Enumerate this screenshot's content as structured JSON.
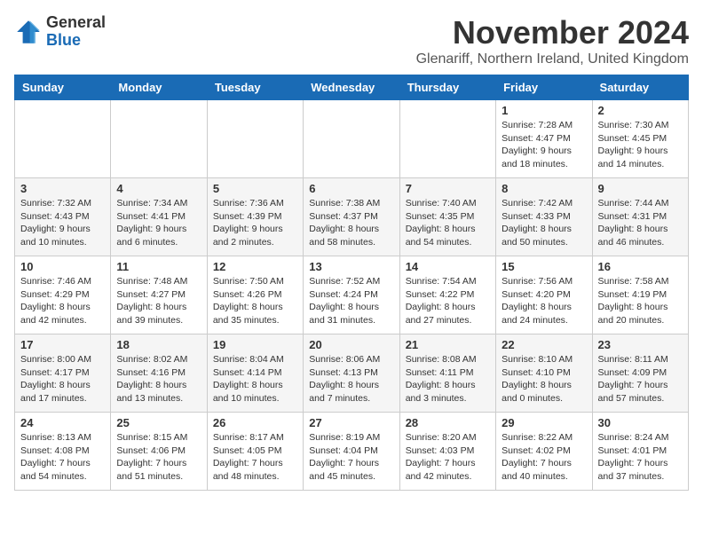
{
  "logo": {
    "general": "General",
    "blue": "Blue"
  },
  "title": "November 2024",
  "location": "Glenariff, Northern Ireland, United Kingdom",
  "days_of_week": [
    "Sunday",
    "Monday",
    "Tuesday",
    "Wednesday",
    "Thursday",
    "Friday",
    "Saturday"
  ],
  "weeks": [
    [
      {
        "day": "",
        "detail": ""
      },
      {
        "day": "",
        "detail": ""
      },
      {
        "day": "",
        "detail": ""
      },
      {
        "day": "",
        "detail": ""
      },
      {
        "day": "",
        "detail": ""
      },
      {
        "day": "1",
        "detail": "Sunrise: 7:28 AM\nSunset: 4:47 PM\nDaylight: 9 hours and 18 minutes."
      },
      {
        "day": "2",
        "detail": "Sunrise: 7:30 AM\nSunset: 4:45 PM\nDaylight: 9 hours and 14 minutes."
      }
    ],
    [
      {
        "day": "3",
        "detail": "Sunrise: 7:32 AM\nSunset: 4:43 PM\nDaylight: 9 hours and 10 minutes."
      },
      {
        "day": "4",
        "detail": "Sunrise: 7:34 AM\nSunset: 4:41 PM\nDaylight: 9 hours and 6 minutes."
      },
      {
        "day": "5",
        "detail": "Sunrise: 7:36 AM\nSunset: 4:39 PM\nDaylight: 9 hours and 2 minutes."
      },
      {
        "day": "6",
        "detail": "Sunrise: 7:38 AM\nSunset: 4:37 PM\nDaylight: 8 hours and 58 minutes."
      },
      {
        "day": "7",
        "detail": "Sunrise: 7:40 AM\nSunset: 4:35 PM\nDaylight: 8 hours and 54 minutes."
      },
      {
        "day": "8",
        "detail": "Sunrise: 7:42 AM\nSunset: 4:33 PM\nDaylight: 8 hours and 50 minutes."
      },
      {
        "day": "9",
        "detail": "Sunrise: 7:44 AM\nSunset: 4:31 PM\nDaylight: 8 hours and 46 minutes."
      }
    ],
    [
      {
        "day": "10",
        "detail": "Sunrise: 7:46 AM\nSunset: 4:29 PM\nDaylight: 8 hours and 42 minutes."
      },
      {
        "day": "11",
        "detail": "Sunrise: 7:48 AM\nSunset: 4:27 PM\nDaylight: 8 hours and 39 minutes."
      },
      {
        "day": "12",
        "detail": "Sunrise: 7:50 AM\nSunset: 4:26 PM\nDaylight: 8 hours and 35 minutes."
      },
      {
        "day": "13",
        "detail": "Sunrise: 7:52 AM\nSunset: 4:24 PM\nDaylight: 8 hours and 31 minutes."
      },
      {
        "day": "14",
        "detail": "Sunrise: 7:54 AM\nSunset: 4:22 PM\nDaylight: 8 hours and 27 minutes."
      },
      {
        "day": "15",
        "detail": "Sunrise: 7:56 AM\nSunset: 4:20 PM\nDaylight: 8 hours and 24 minutes."
      },
      {
        "day": "16",
        "detail": "Sunrise: 7:58 AM\nSunset: 4:19 PM\nDaylight: 8 hours and 20 minutes."
      }
    ],
    [
      {
        "day": "17",
        "detail": "Sunrise: 8:00 AM\nSunset: 4:17 PM\nDaylight: 8 hours and 17 minutes."
      },
      {
        "day": "18",
        "detail": "Sunrise: 8:02 AM\nSunset: 4:16 PM\nDaylight: 8 hours and 13 minutes."
      },
      {
        "day": "19",
        "detail": "Sunrise: 8:04 AM\nSunset: 4:14 PM\nDaylight: 8 hours and 10 minutes."
      },
      {
        "day": "20",
        "detail": "Sunrise: 8:06 AM\nSunset: 4:13 PM\nDaylight: 8 hours and 7 minutes."
      },
      {
        "day": "21",
        "detail": "Sunrise: 8:08 AM\nSunset: 4:11 PM\nDaylight: 8 hours and 3 minutes."
      },
      {
        "day": "22",
        "detail": "Sunrise: 8:10 AM\nSunset: 4:10 PM\nDaylight: 8 hours and 0 minutes."
      },
      {
        "day": "23",
        "detail": "Sunrise: 8:11 AM\nSunset: 4:09 PM\nDaylight: 7 hours and 57 minutes."
      }
    ],
    [
      {
        "day": "24",
        "detail": "Sunrise: 8:13 AM\nSunset: 4:08 PM\nDaylight: 7 hours and 54 minutes."
      },
      {
        "day": "25",
        "detail": "Sunrise: 8:15 AM\nSunset: 4:06 PM\nDaylight: 7 hours and 51 minutes."
      },
      {
        "day": "26",
        "detail": "Sunrise: 8:17 AM\nSunset: 4:05 PM\nDaylight: 7 hours and 48 minutes."
      },
      {
        "day": "27",
        "detail": "Sunrise: 8:19 AM\nSunset: 4:04 PM\nDaylight: 7 hours and 45 minutes."
      },
      {
        "day": "28",
        "detail": "Sunrise: 8:20 AM\nSunset: 4:03 PM\nDaylight: 7 hours and 42 minutes."
      },
      {
        "day": "29",
        "detail": "Sunrise: 8:22 AM\nSunset: 4:02 PM\nDaylight: 7 hours and 40 minutes."
      },
      {
        "day": "30",
        "detail": "Sunrise: 8:24 AM\nSunset: 4:01 PM\nDaylight: 7 hours and 37 minutes."
      }
    ]
  ]
}
